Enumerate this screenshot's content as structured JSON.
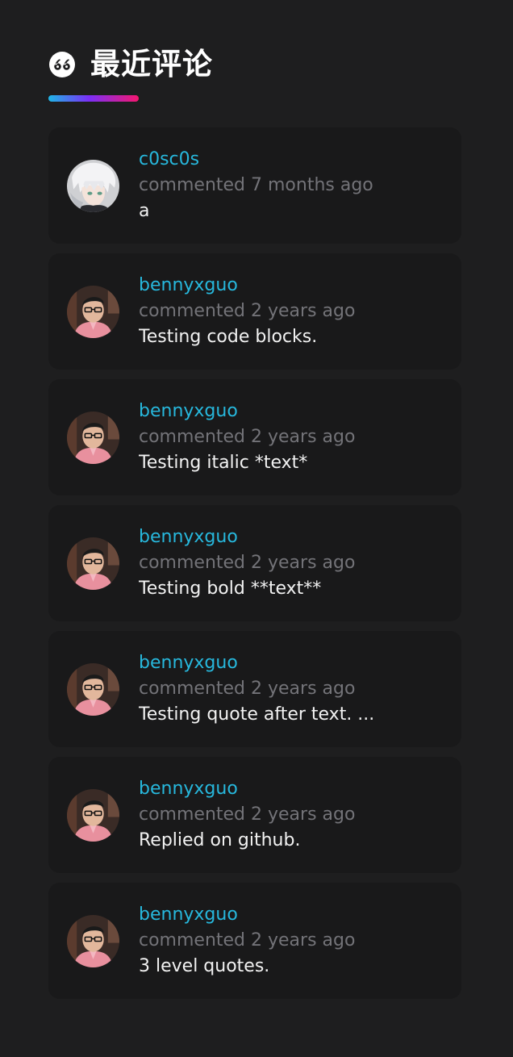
{
  "widget": {
    "title": "最近评论",
    "icon": "quote-icon",
    "accent_gradient": [
      "#1fb6e6",
      "#7b2ff7",
      "#f5176f"
    ]
  },
  "comments": [
    {
      "author": "c0sc0s",
      "meta": "commented 7 months ago",
      "text": "a",
      "avatar": "anime-avatar"
    },
    {
      "author": "bennyxguo",
      "meta": "commented 2 years ago",
      "text": "Testing code blocks.",
      "avatar": "photo-avatar"
    },
    {
      "author": "bennyxguo",
      "meta": "commented 2 years ago",
      "text": "Testing italic *text*",
      "avatar": "photo-avatar"
    },
    {
      "author": "bennyxguo",
      "meta": "commented 2 years ago",
      "text": "Testing bold **text**",
      "avatar": "photo-avatar"
    },
    {
      "author": "bennyxguo",
      "meta": "commented 2 years ago",
      "text": "Testing quote after text. ...",
      "avatar": "photo-avatar"
    },
    {
      "author": "bennyxguo",
      "meta": "commented 2 years ago",
      "text": "Replied on github.",
      "avatar": "photo-avatar"
    },
    {
      "author": "bennyxguo",
      "meta": "commented 2 years ago",
      "text": "3 level quotes.",
      "avatar": "photo-avatar"
    }
  ],
  "colors": {
    "background": "#1e1e1f",
    "card": "#19191a",
    "author": "#27b8dd",
    "meta": "#737378",
    "text": "#f2f2f2"
  }
}
